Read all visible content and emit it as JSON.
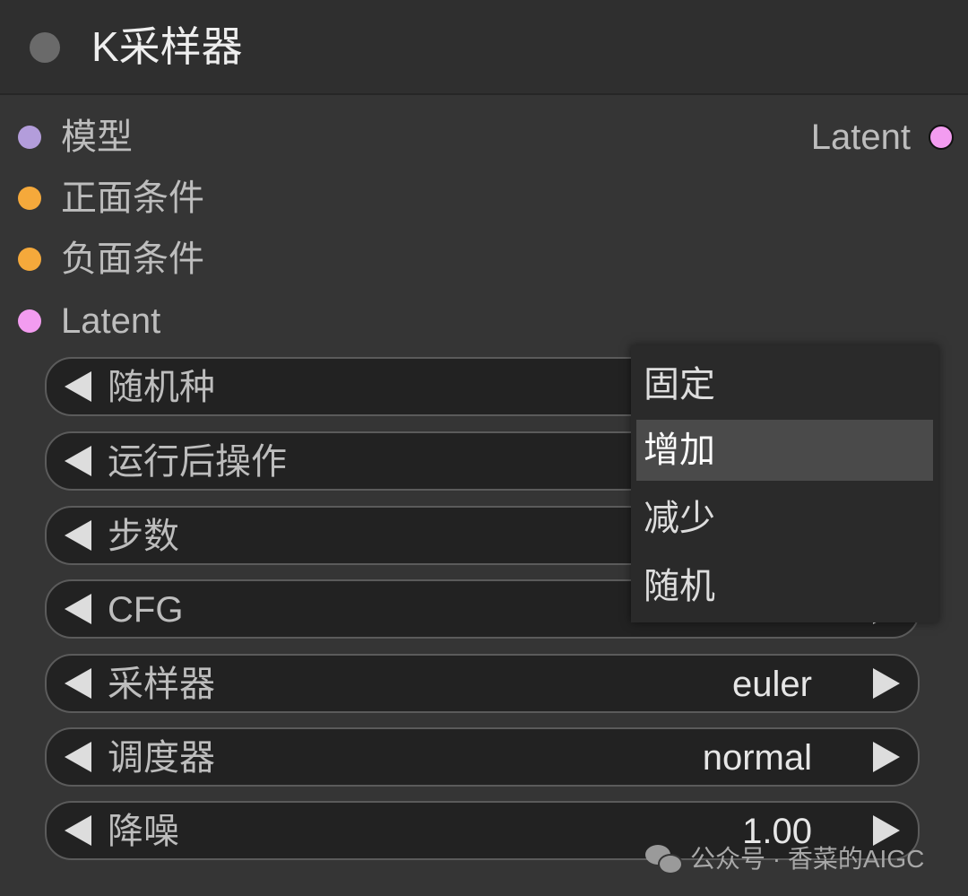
{
  "node": {
    "title": "K采样器"
  },
  "inputs": [
    {
      "label": "模型",
      "color": "#b39ddb"
    },
    {
      "label": "正面条件",
      "color": "#f5a93b"
    },
    {
      "label": "负面条件",
      "color": "#f5a93b"
    },
    {
      "label": "Latent",
      "color": "#f39cf0"
    }
  ],
  "output": {
    "label": "Latent",
    "color": "#f39cf0"
  },
  "widgets": [
    {
      "label": "随机种",
      "value": ""
    },
    {
      "label": "运行后操作",
      "value": ""
    },
    {
      "label": "步数",
      "value": ""
    },
    {
      "label": "CFG",
      "value": ""
    },
    {
      "label": "采样器",
      "value": "euler"
    },
    {
      "label": "调度器",
      "value": "normal"
    },
    {
      "label": "降噪",
      "value": "1.00"
    }
  ],
  "context_menu": {
    "items": [
      {
        "label": "固定",
        "highlighted": false
      },
      {
        "label": "增加",
        "highlighted": true
      },
      {
        "label": "减少",
        "highlighted": false
      },
      {
        "label": "随机",
        "highlighted": false
      }
    ]
  },
  "watermark": {
    "icon": "wechat-icon",
    "text": "公众号 · 香菜的AIGC"
  }
}
